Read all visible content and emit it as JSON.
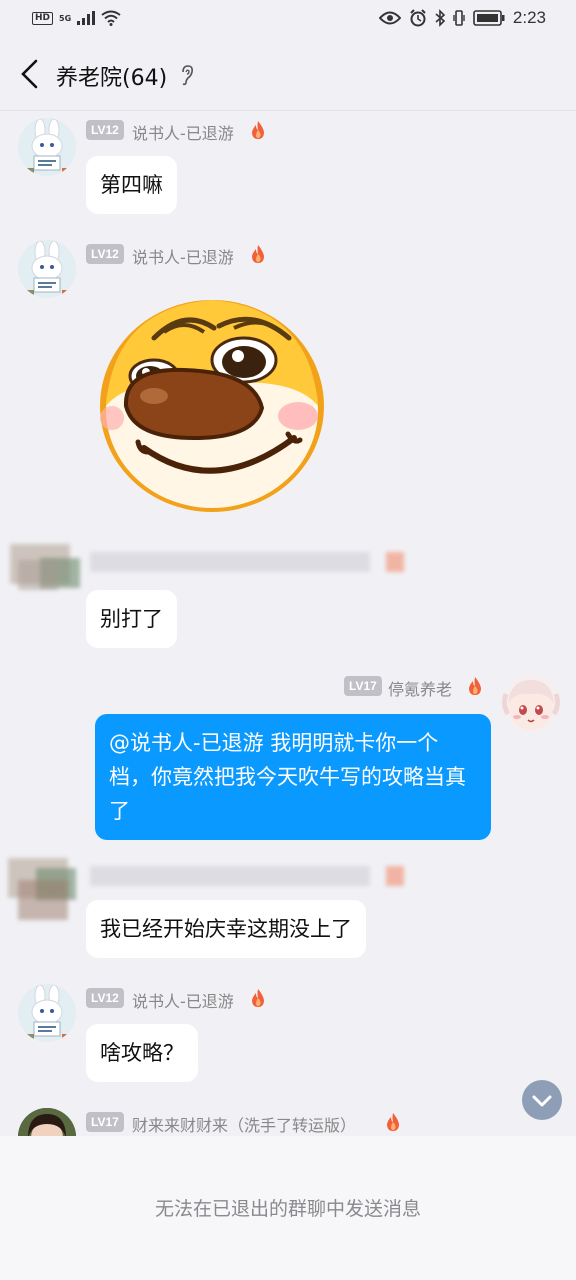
{
  "status_bar": {
    "hd": "HD",
    "network": "5G",
    "time": "2:23"
  },
  "header": {
    "title": "养老院(64)"
  },
  "messages": [
    {
      "level": "LV12",
      "nick": "说书人-已退游",
      "text": "第四嘛"
    },
    {
      "level": "LV12",
      "nick": "说书人-已退游",
      "sticker": "dog-face-sticker"
    },
    {
      "text": "别打了"
    },
    {
      "level": "LV17",
      "nick": "停氪养老",
      "text": "@说书人-已退游 我明明就卡你一个档，你竟然把我今天吹牛写的攻略当真了"
    },
    {
      "text": "我已经开始庆幸这期没上了"
    },
    {
      "level": "LV12",
      "nick": "说书人-已退游",
      "text": "啥攻略？"
    },
    {
      "level": "LV17",
      "nick": "财来来财财来（洗手了转运版）"
    }
  ],
  "footer": {
    "notice": "无法在已退出的群聊中发送消息"
  },
  "colors": {
    "bubble_mine": "#0a99ff",
    "background": "#f1f1f5",
    "level_badge": "#c0c0c6",
    "flame": "#f0603a"
  }
}
